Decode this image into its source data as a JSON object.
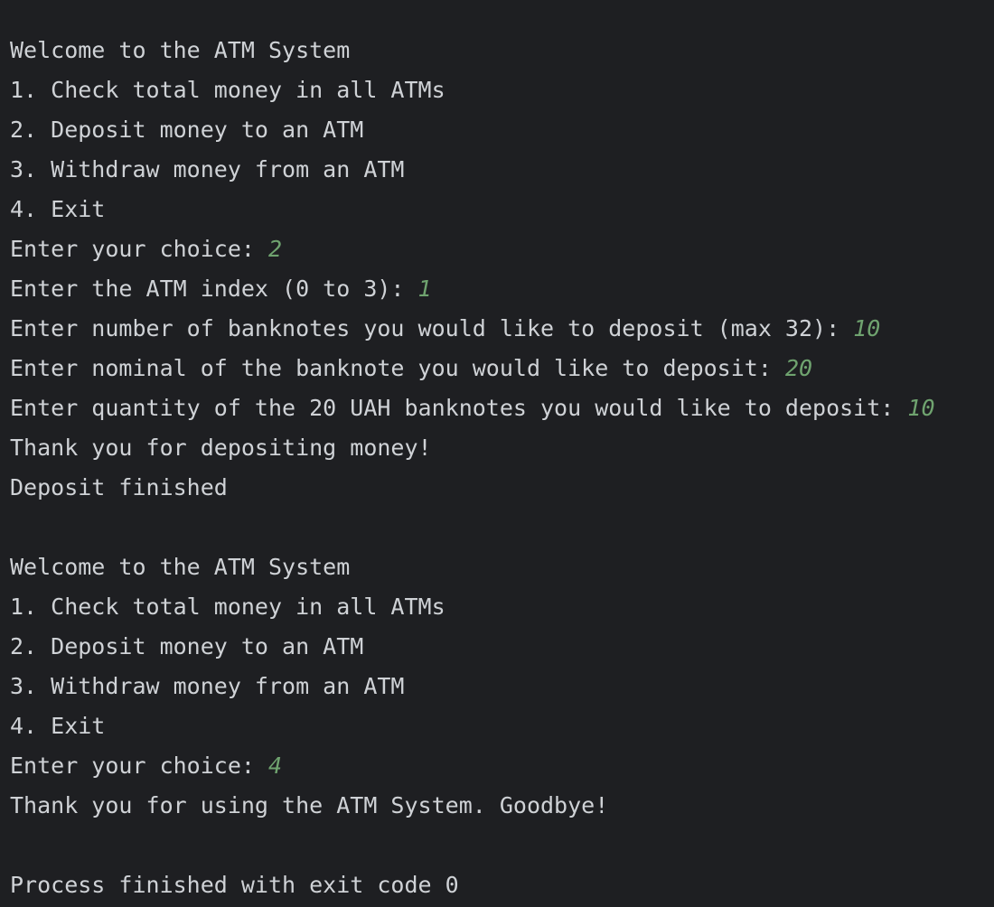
{
  "console": {
    "lines": [
      {
        "text": "Welcome to the ATM System",
        "input": ""
      },
      {
        "text": "1. Check total money in all ATMs",
        "input": ""
      },
      {
        "text": "2. Deposit money to an ATM",
        "input": ""
      },
      {
        "text": "3. Withdraw money from an ATM",
        "input": ""
      },
      {
        "text": "4. Exit",
        "input": ""
      },
      {
        "text": "Enter your choice: ",
        "input": "2"
      },
      {
        "text": "Enter the ATM index (0 to 3): ",
        "input": "1"
      },
      {
        "text": "Enter number of banknotes you would like to deposit (max 32): ",
        "input": "10"
      },
      {
        "text": "Enter nominal of the banknote you would like to deposit: ",
        "input": "20"
      },
      {
        "text": "Enter quantity of the 20 UAH banknotes you would like to deposit: ",
        "input": "10"
      },
      {
        "text": "Thank you for depositing money!",
        "input": ""
      },
      {
        "text": "Deposit finished",
        "input": ""
      },
      {
        "text": "",
        "input": ""
      },
      {
        "text": "Welcome to the ATM System",
        "input": ""
      },
      {
        "text": "1. Check total money in all ATMs",
        "input": ""
      },
      {
        "text": "2. Deposit money to an ATM",
        "input": ""
      },
      {
        "text": "3. Withdraw money from an ATM",
        "input": ""
      },
      {
        "text": "4. Exit",
        "input": ""
      },
      {
        "text": "Enter your choice: ",
        "input": "4"
      },
      {
        "text": "Thank you for using the ATM System. Goodbye!",
        "input": ""
      },
      {
        "text": "",
        "input": ""
      },
      {
        "text": "Process finished with exit code 0",
        "input": ""
      }
    ]
  },
  "colors": {
    "background": "#1e1f22",
    "output_text": "#cfd2d6",
    "user_input": "#6fa36f"
  }
}
